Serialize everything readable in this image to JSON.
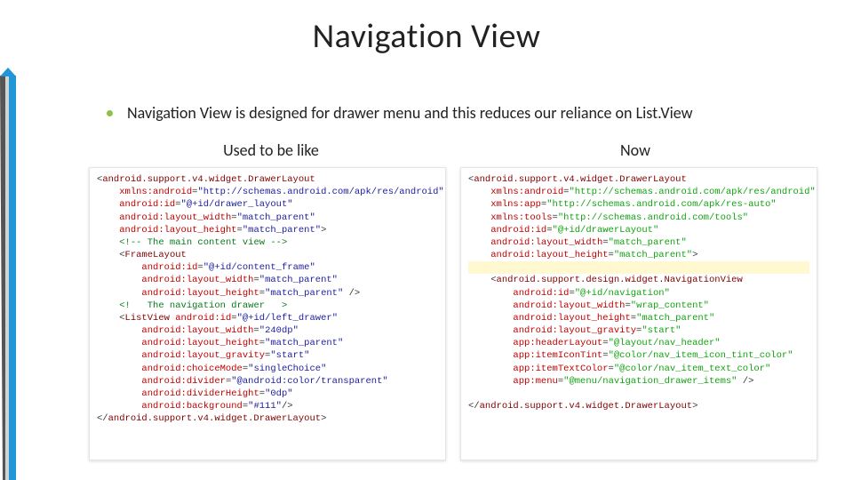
{
  "title": "Navigation View",
  "bullet": "Navigation View is designed for drawer menu and this reduces our reliance on List.View",
  "subhead_left": "Used to be like",
  "subhead_right": "Now",
  "code_left": {
    "l1_open": "<",
    "l1_tag": "android.support.v4.widget.DrawerLayout",
    "l2_attr": "xmlns:android",
    "l2_val": "\"http://schemas.android.com/apk/res/android\"",
    "l3_attr": "android:id",
    "l3_val": "\"@+id/drawer_layout\"",
    "l4_attr": "android:layout_width",
    "l4_val": "\"match_parent\"",
    "l5_attr": "android:layout_height",
    "l5_val": "\"match_parent\"",
    "l5_close": ">",
    "c1": "<!-- The main content view -->",
    "f_open": "<",
    "f_tag": "FrameLayout",
    "f1_attr": "android:id",
    "f1_val": "\"@+id/content_frame\"",
    "f2_attr": "android:layout_width",
    "f2_val": "\"match_parent\"",
    "f3_attr": "android:layout_height",
    "f3_val": "\"match_parent\"",
    "f3_close": " />",
    "c2": "<!   The navigation drawer   >",
    "lv_open": "<",
    "lv_tag": "ListView ",
    "lv_attr0": "android:id",
    "lv_val0": "\"@+id/left_drawer\"",
    "lv1_attr": "android:layout_width",
    "lv1_val": "\"240dp\"",
    "lv2_attr": "android:layout_height",
    "lv2_val": "\"match_parent\"",
    "lv3_attr": "android:layout_gravity",
    "lv3_val": "\"start\"",
    "lv4_attr": "android:choiceMode",
    "lv4_val": "\"singleChoice\"",
    "lv5_attr": "android:divider",
    "lv5_val": "\"@android:color/transparent\"",
    "lv6_attr": "android:dividerHeight",
    "lv6_val": "\"0dp\"",
    "lv7_attr": "android:background",
    "lv7_val": "\"#111\"",
    "lv7_close": "/>",
    "end_open": "</",
    "end_tag": "android.support.v4.widget.DrawerLayout",
    "end_close": ">"
  },
  "code_right": {
    "l1_open": "<",
    "l1_tag": "android.support.v4.widget.DrawerLayout",
    "l2_attr": "xmlns:android",
    "l2_val": "\"http://schemas.android.com/apk/res/android\"",
    "l3_attr": "xmlns:app",
    "l3_val": "\"http://schemas.android.com/apk/res-auto\"",
    "l4_attr": "xmlns:tools",
    "l4_val": "\"http://schemas.android.com/tools\"",
    "l5_attr": "android:id",
    "l5_val": "\"@+id/drawerLayout\"",
    "l6_attr": "android:layout_width",
    "l6_val": "\"match_parent\"",
    "l7_attr": "android:layout_height",
    "l7_val": "\"match_parent\"",
    "l7_close": ">",
    "gap": " ",
    "nv_open": "<",
    "nv_tag": "android.support.design.widget.NavigationView",
    "n1_attr": "android:id",
    "n1_val": "\"@+id/navigation\"",
    "n2_attr": "android:layout_width",
    "n2_val": "\"wrap_content\"",
    "n3_attr": "android:layout_height",
    "n3_val": "\"match_parent\"",
    "n4_attr": "android:layout_gravity",
    "n4_val": "\"start\"",
    "n5_attr": "app:headerLayout",
    "n5_val": "\"@layout/nav_header\"",
    "n6_attr": "app:itemIconTint",
    "n6_val": "\"@color/nav_item_icon_tint_color\"",
    "n7_attr": "app:itemTextColor",
    "n7_val": "\"@color/nav_item_text_color\"",
    "n8_attr": "app:menu",
    "n8_val": "\"@menu/navigation_drawer_items\"",
    "n8_close": " />",
    "blank": " ",
    "end_open": "</",
    "end_tag": "android.support.v4.widget.DrawerLayout",
    "end_close": ">"
  }
}
